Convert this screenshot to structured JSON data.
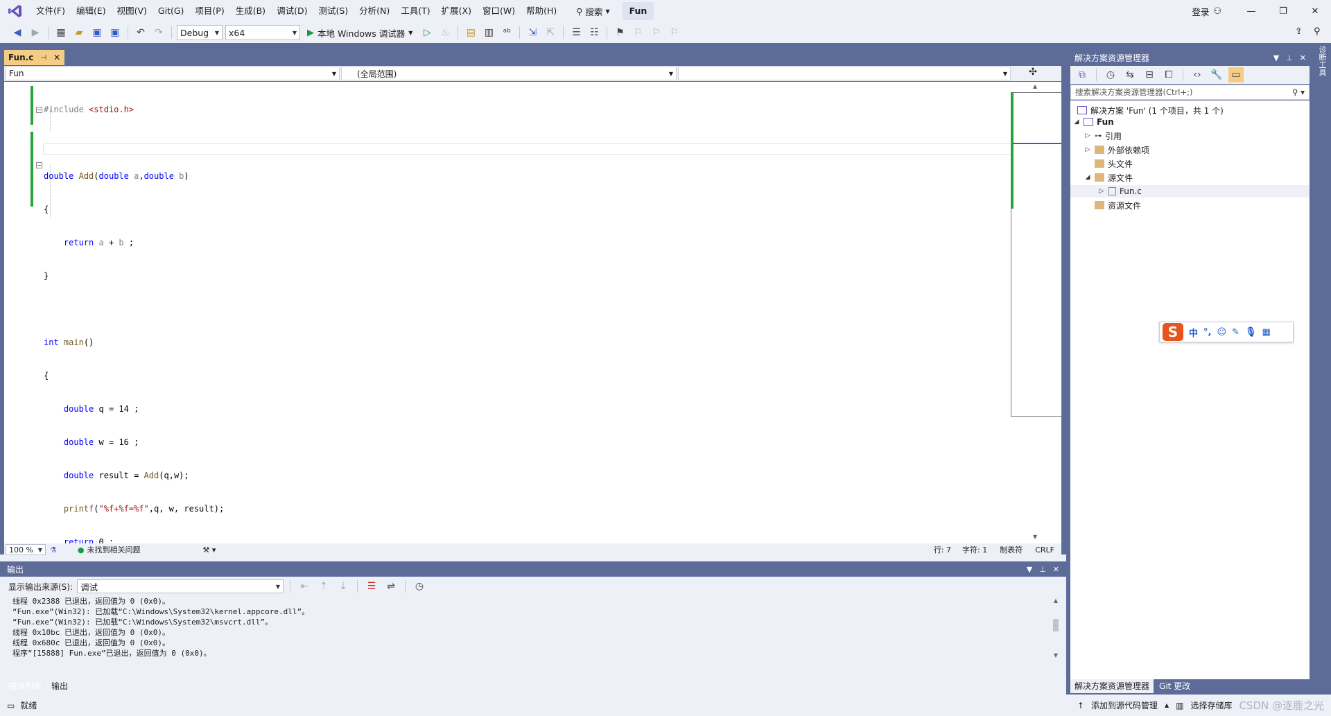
{
  "titlebar": {
    "menu": [
      "文件(F)",
      "编辑(E)",
      "视图(V)",
      "Git(G)",
      "项目(P)",
      "生成(B)",
      "调试(D)",
      "测试(S)",
      "分析(N)",
      "工具(T)",
      "扩展(X)",
      "窗口(W)",
      "帮助(H)"
    ],
    "search_label": "搜索",
    "solution_name": "Fun",
    "login_label": "登录"
  },
  "toolbar": {
    "config": "Debug",
    "platform": "x64",
    "run_label": "本地 Windows 调试器"
  },
  "editor": {
    "tab_label": "Fun.c",
    "nav_project": "Fun",
    "nav_scope": "(全局范围)",
    "nav_member": "",
    "code": {
      "l1_pre": "#include ",
      "l1_hdr": "<stdio.h>",
      "l3_type": "double",
      "l3_fn": "Add",
      "l3_p1t": "double",
      "l3_p1n": "a",
      "l3_p2t": "double",
      "l3_p2n": "b",
      "l5_ret": "return",
      "l5_rest_a": "a",
      "l5_rest_b": "b",
      "l8_type": "int",
      "l8_fn": "main",
      "l10_t": "double",
      "l10_v": "q",
      "l10_n": "14",
      "l11_t": "double",
      "l11_v": "w",
      "l11_n": "16",
      "l12_t": "double",
      "l12_v": "result",
      "l12_fn": "Add",
      "l12_args_q": "q",
      "l12_args_w": "w",
      "l13_fn": "printf",
      "l13_str": "\"%f+%f=%f\"",
      "l13_q": "q",
      "l13_w": "w",
      "l13_r": "result",
      "l14_ret": "return",
      "l14_n": "0"
    },
    "zoom": "100 %",
    "issues": "未找到相关问题",
    "line": "行: 7",
    "char": "字符: 1",
    "tabs_mode": "制表符",
    "eol": "CRLF"
  },
  "output": {
    "title": "输出",
    "source_label": "显示输出来源(S):",
    "source_value": "调试",
    "lines": [
      "线程 0x2388 已退出，返回值为 0 (0x0)。",
      "“Fun.exe”(Win32): 已加载“C:\\Windows\\System32\\kernel.appcore.dll”。",
      "“Fun.exe”(Win32): 已加载“C:\\Windows\\System32\\msvcrt.dll”。",
      "线程 0x10bc 已退出，返回值为 0 (0x0)。",
      "线程 0x680c 已退出，返回值为 0 (0x0)。",
      "程序“[15888] Fun.exe”已退出，返回值为 0 (0x0)。"
    ],
    "tabs": [
      "错误列表",
      "输出"
    ]
  },
  "solution_explorer": {
    "title": "解决方案资源管理器",
    "search_placeholder": "搜索解决方案资源管理器(Ctrl+;)",
    "solution_node": "解决方案 'Fun' (1 个项目，共 1 个)",
    "project": "Fun",
    "nodes": [
      "引用",
      "外部依赖项",
      "头文件",
      "源文件",
      "Fun.c",
      "资源文件"
    ],
    "tabs": [
      "解决方案资源管理器",
      "Git 更改"
    ],
    "side_tab": "诊断工具"
  },
  "ime": {
    "chars": [
      "中",
      "°,"
    ]
  },
  "statusbar": {
    "ready": "就绪",
    "source_control": "添加到源代码管理",
    "repo": "选择存储库",
    "watermark": "CSDN @逐鹿之光"
  },
  "colors": {
    "accent": "#5d6b99",
    "tab_active": "#f5cc84",
    "change_bar": "#2aa43a",
    "keyword": "#0000ff",
    "string": "#a31515"
  }
}
